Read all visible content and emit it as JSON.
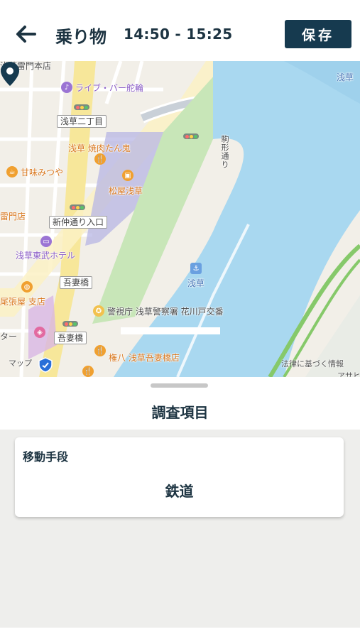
{
  "header": {
    "back_icon": "arrow-left-icon",
    "title": "乗り物",
    "time_range": "14:50 - 15:25",
    "save_label": "保存"
  },
  "map": {
    "labels": {
      "live_bar": "ライブ・バー舵輪",
      "asakusa_2chome": "浅草二丁目",
      "yakiniku": "浅草 焼肉たん鬼",
      "amami": "甘味みつや",
      "matsuya": "松屋浅草",
      "kaminarimon": "雷門店",
      "shinnakamise": "新仲通り入口",
      "tobu_hotel": "浅草東武ホテル",
      "azumabashi_1": "吾妻橋",
      "owariya": "尾張屋 支店",
      "keishicho": "警視庁 浅草警察署 花川戸交番",
      "azumabashi_2": "吾妻橋",
      "gonpachi": "権八 浅草吾妻橋店",
      "asakusa_station": "浅草",
      "asakusa_top_right": "浅草",
      "road_vertical": "駒形通り",
      "center_left": "ター",
      "top_left": "浅草雷門本店"
    },
    "credit_maps": "マップ",
    "credit_legal": "法律に基づく情報",
    "credit_asahi": "アサヒ"
  },
  "sheet": {
    "title": "調査項目",
    "card": {
      "label": "移動手段",
      "value": "鉄道"
    }
  },
  "colors": {
    "primary": "#163a4f",
    "text": "#1d3442",
    "river": "#a9d8f0",
    "park": "#c8e6b8"
  }
}
